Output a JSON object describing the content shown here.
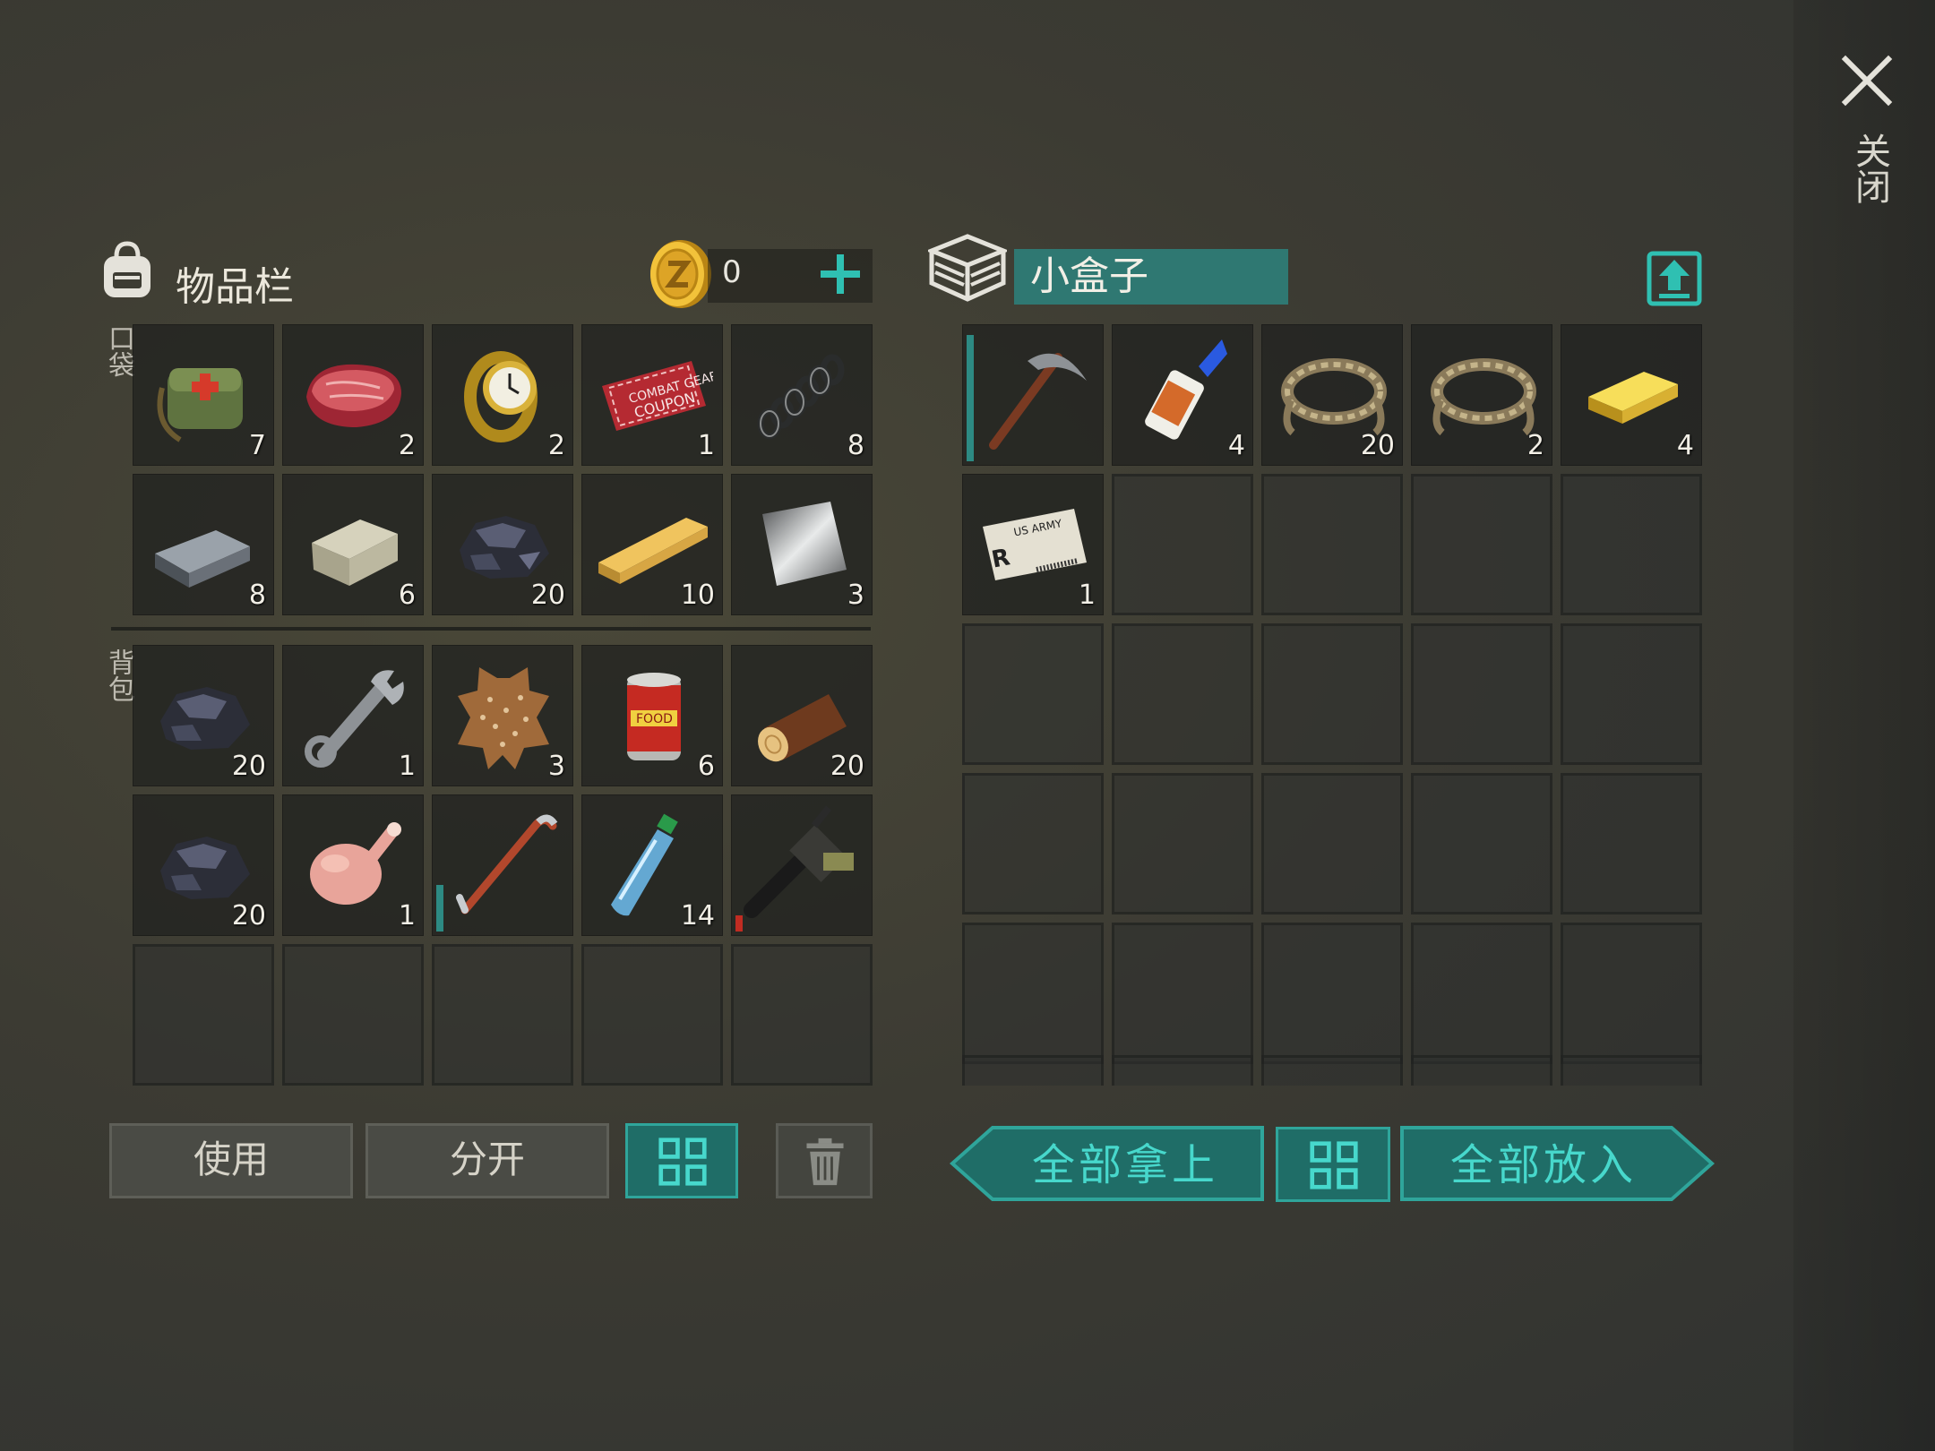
{
  "close": {
    "label": "关闭",
    "icon": "close-icon"
  },
  "inventory": {
    "title": "物品栏",
    "coins": "0",
    "pockets_label": "口袋",
    "backpack_label": "背包",
    "pockets": [
      {
        "icon": "medkit-bag-icon",
        "count": "7"
      },
      {
        "icon": "raw-meat-icon",
        "count": "2"
      },
      {
        "icon": "gold-watch-icon",
        "count": "2"
      },
      {
        "icon": "combat-gear-coupon-icon",
        "count": "1"
      },
      {
        "icon": "spring-icon",
        "count": "8"
      },
      {
        "icon": "iron-bar-icon",
        "count": "8"
      },
      {
        "icon": "stone-block-icon",
        "count": "6"
      },
      {
        "icon": "iron-ore-icon",
        "count": "20"
      },
      {
        "icon": "wood-plank-icon",
        "count": "10"
      },
      {
        "icon": "metal-sheet-icon",
        "count": "3"
      }
    ],
    "backpack": [
      {
        "icon": "iron-ore-icon",
        "count": "20"
      },
      {
        "icon": "wrench-icon",
        "count": "1"
      },
      {
        "icon": "leather-hide-icon",
        "count": "3"
      },
      {
        "icon": "canned-food-icon",
        "count": "6"
      },
      {
        "icon": "log-icon",
        "count": "20"
      },
      {
        "icon": "iron-ore-icon",
        "count": "20"
      },
      {
        "icon": "raw-chicken-icon",
        "count": "1"
      },
      {
        "icon": "crowbar-icon",
        "count": "",
        "durability": 0.35
      },
      {
        "icon": "water-bottle-icon",
        "count": "14"
      },
      {
        "icon": "chainsaw-gun-icon",
        "count": "",
        "durability": 0.12
      }
    ]
  },
  "box": {
    "name": "小盒子",
    "items": [
      {
        "icon": "pickaxe-icon",
        "count": "",
        "durability": 0.95
      },
      {
        "icon": "super-glue-icon",
        "count": "4"
      },
      {
        "icon": "rope-icon",
        "count": "20"
      },
      {
        "icon": "rope-icon",
        "count": "2"
      },
      {
        "icon": "gold-bar-icon",
        "count": "4"
      },
      {
        "icon": "us-army-card-icon",
        "count": "1"
      }
    ]
  },
  "buttons": {
    "use": "使用",
    "split": "分开",
    "take_all": "全部拿上",
    "put_all": "全部放入"
  },
  "colors": {
    "accent": "#2fa59b",
    "accent_text": "#47d8cc",
    "durability_good": "#2d8a83",
    "durability_low": "#c02c22"
  }
}
